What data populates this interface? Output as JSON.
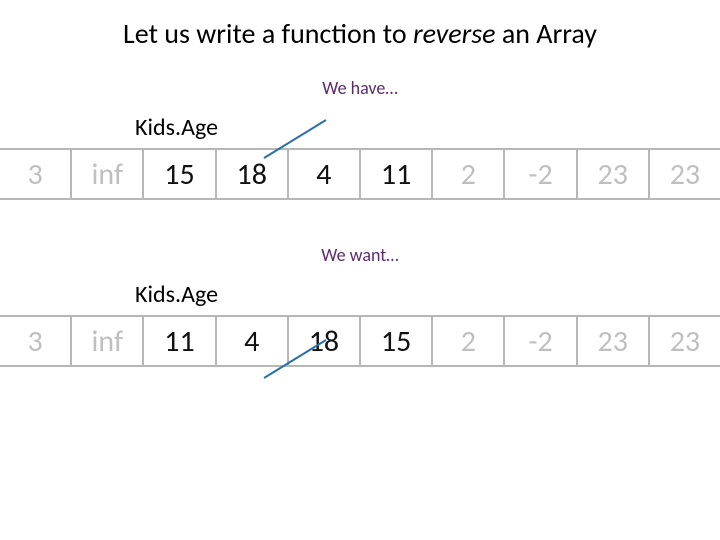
{
  "title_prefix": "Let us write a function to ",
  "title_emph": "reverse",
  "title_suffix": " an Array",
  "caption_have": "We have…",
  "caption_want": "We want…",
  "varname": "Kids.Age",
  "chart_data": [
    {
      "type": "table",
      "title": "We have…",
      "label": "Kids.Age",
      "cells": [
        {
          "value": "3",
          "faded": true
        },
        {
          "value": "inf",
          "faded": true
        },
        {
          "value": "15",
          "faded": false
        },
        {
          "value": "18",
          "faded": false
        },
        {
          "value": "4",
          "faded": false
        },
        {
          "value": "11",
          "faded": false
        },
        {
          "value": "2",
          "faded": true
        },
        {
          "value": "-2",
          "faded": true
        },
        {
          "value": "23",
          "faded": true
        },
        {
          "value": "23",
          "faded": true
        }
      ]
    },
    {
      "type": "table",
      "title": "We want…",
      "label": "Kids.Age",
      "cells": [
        {
          "value": "3",
          "faded": true
        },
        {
          "value": "inf",
          "faded": true
        },
        {
          "value": "11",
          "faded": false
        },
        {
          "value": "4",
          "faded": false
        },
        {
          "value": "18",
          "faded": false
        },
        {
          "value": "15",
          "faded": false
        },
        {
          "value": "2",
          "faded": true
        },
        {
          "value": "-2",
          "faded": true
        },
        {
          "value": "23",
          "faded": true
        },
        {
          "value": "23",
          "faded": true
        }
      ]
    }
  ]
}
